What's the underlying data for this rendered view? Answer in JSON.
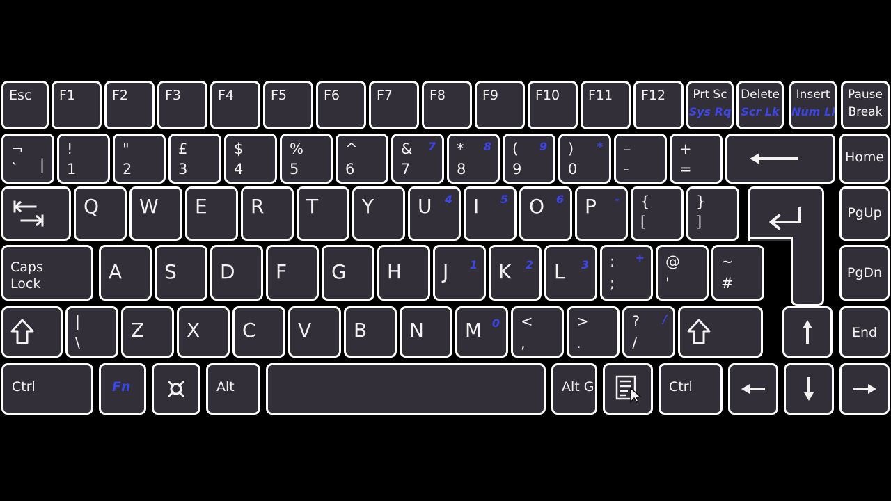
{
  "device": {
    "name": "laptop-keyboard",
    "layout": "UK ISO",
    "background_color": "#000000",
    "key_fill_color": "#332F38",
    "key_border_color": "#FFFFFF",
    "primary_legend_color": "#F2F2F2",
    "secondary_legend_color": "#3B46E8"
  },
  "rows": {
    "function_row": [
      {
        "main": "Esc"
      },
      {
        "main": "F1"
      },
      {
        "main": "F2"
      },
      {
        "main": "F3"
      },
      {
        "main": "F4"
      },
      {
        "main": "F5"
      },
      {
        "main": "F6"
      },
      {
        "main": "F7"
      },
      {
        "main": "F8"
      },
      {
        "main": "F9"
      },
      {
        "main": "F10"
      },
      {
        "main": "F11"
      },
      {
        "main": "F12"
      },
      {
        "main": "Prt Sc",
        "alt": "Sys Rq"
      },
      {
        "main": "Delete",
        "alt": "Scr Lk"
      },
      {
        "main": "Insert",
        "alt": "Num Lk"
      },
      {
        "main": "Pause",
        "main2": "Break"
      }
    ],
    "number_row": [
      {
        "upper": "¬",
        "lower": "`",
        "extra": "|"
      },
      {
        "upper": "!",
        "lower": "1"
      },
      {
        "upper": "\"",
        "lower": "2"
      },
      {
        "upper": "£",
        "lower": "3"
      },
      {
        "upper": "$",
        "lower": "4"
      },
      {
        "upper": "%",
        "lower": "5"
      },
      {
        "upper": "^",
        "lower": "6"
      },
      {
        "upper": "&",
        "lower": "7",
        "alt": "7"
      },
      {
        "upper": "*",
        "lower": "8",
        "alt": "8"
      },
      {
        "upper": "(",
        "lower": "9",
        "alt": "9"
      },
      {
        "upper": ")",
        "lower": "0",
        "alt": "*"
      },
      {
        "upper": "–",
        "lower": "-"
      },
      {
        "upper": "+",
        "lower": "="
      },
      {
        "main": "backspace-arrow-icon"
      },
      {
        "main": "Home"
      }
    ],
    "qwerty_row": [
      {
        "main": "tab-icon"
      },
      {
        "main": "Q"
      },
      {
        "main": "W"
      },
      {
        "main": "E"
      },
      {
        "main": "R"
      },
      {
        "main": "T"
      },
      {
        "main": "Y"
      },
      {
        "main": "U",
        "alt": "4"
      },
      {
        "main": "I",
        "alt": "5"
      },
      {
        "main": "O",
        "alt": "6"
      },
      {
        "main": "P",
        "alt": "-"
      },
      {
        "upper": "{",
        "lower": "["
      },
      {
        "upper": "}",
        "lower": "]"
      },
      {
        "main": "enter-icon"
      },
      {
        "main": "PgUp"
      }
    ],
    "home_row": [
      {
        "main": "Caps",
        "main2": "Lock"
      },
      {
        "main": "A"
      },
      {
        "main": "S"
      },
      {
        "main": "D"
      },
      {
        "main": "F"
      },
      {
        "main": "G"
      },
      {
        "main": "H"
      },
      {
        "main": "J",
        "alt": "1"
      },
      {
        "main": "K",
        "alt": "2"
      },
      {
        "main": "L",
        "alt": "3"
      },
      {
        "upper": ":",
        "lower": ";",
        "alt": "+"
      },
      {
        "upper": "@",
        "lower": "'"
      },
      {
        "upper": "~",
        "lower": "#"
      },
      {
        "main": "PgDn"
      }
    ],
    "shift_row": [
      {
        "main": "shift-arrow-icon"
      },
      {
        "upper": "|",
        "lower": "\\"
      },
      {
        "main": "Z"
      },
      {
        "main": "X"
      },
      {
        "main": "C"
      },
      {
        "main": "V"
      },
      {
        "main": "B"
      },
      {
        "main": "N"
      },
      {
        "main": "M",
        "alt": "0"
      },
      {
        "upper": "<",
        "lower": ","
      },
      {
        "upper": ">",
        "lower": "."
      },
      {
        "upper": "?",
        "lower": "/",
        "alt": "/"
      },
      {
        "main": "shift-arrow-icon"
      },
      {
        "main": "arrow-up-icon"
      },
      {
        "main": "End"
      }
    ],
    "bottom_row": [
      {
        "main": "Ctrl"
      },
      {
        "main": "Fn",
        "is_alt_color": true
      },
      {
        "main": "super-icon"
      },
      {
        "main": "Alt"
      },
      {
        "main": "space"
      },
      {
        "main": "Alt Gr"
      },
      {
        "main": "menu-icon"
      },
      {
        "main": "Ctrl"
      },
      {
        "main": "arrow-left-icon"
      },
      {
        "main": "arrow-down-icon"
      },
      {
        "main": "arrow-right-icon"
      }
    ]
  }
}
